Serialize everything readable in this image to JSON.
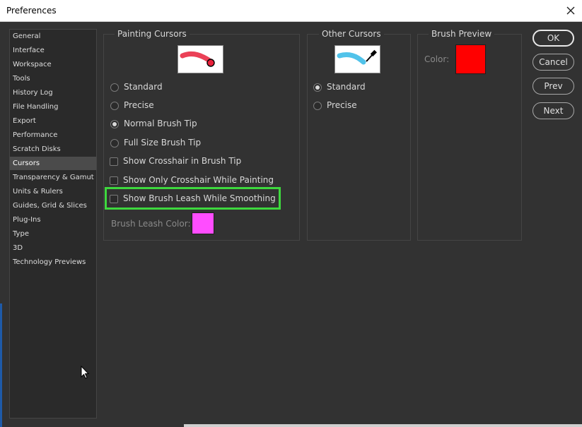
{
  "window": {
    "title": "Preferences"
  },
  "sidebar": {
    "items": [
      {
        "label": "General"
      },
      {
        "label": "Interface"
      },
      {
        "label": "Workspace"
      },
      {
        "label": "Tools"
      },
      {
        "label": "History Log"
      },
      {
        "label": "File Handling"
      },
      {
        "label": "Export"
      },
      {
        "label": "Performance"
      },
      {
        "label": "Scratch Disks"
      },
      {
        "label": "Cursors"
      },
      {
        "label": "Transparency & Gamut"
      },
      {
        "label": "Units & Rulers"
      },
      {
        "label": "Guides, Grid & Slices"
      },
      {
        "label": "Plug-Ins"
      },
      {
        "label": "Type"
      },
      {
        "label": "3D"
      },
      {
        "label": "Technology Previews"
      }
    ],
    "selected": "Cursors"
  },
  "painting_cursors": {
    "title": "Painting Cursors",
    "radios": [
      {
        "label": "Standard",
        "checked": false
      },
      {
        "label": "Precise",
        "checked": false
      },
      {
        "label": "Normal Brush Tip",
        "checked": true
      },
      {
        "label": "Full Size Brush Tip",
        "checked": false
      }
    ],
    "checkboxes": [
      {
        "label": "Show Crosshair in Brush Tip",
        "checked": false
      },
      {
        "label": "Show Only Crosshair While Painting",
        "checked": false
      },
      {
        "label": "Show Brush Leash While Smoothing",
        "checked": false
      }
    ],
    "leash_color_label": "Brush Leash Color:",
    "leash_color": "#ff4dff",
    "preview_stroke_color": "#e8203a"
  },
  "other_cursors": {
    "title": "Other Cursors",
    "radios": [
      {
        "label": "Standard",
        "checked": true
      },
      {
        "label": "Precise",
        "checked": false
      }
    ],
    "preview_stroke_color": "#33b8e6"
  },
  "brush_preview": {
    "title": "Brush Preview",
    "color_label": "Color:",
    "color": "#ff0000"
  },
  "buttons": {
    "ok": "OK",
    "cancel": "Cancel",
    "prev": "Prev",
    "next": "Next"
  },
  "colors": {
    "highlight": "#3ed83e",
    "dialog_bg": "#323232"
  }
}
